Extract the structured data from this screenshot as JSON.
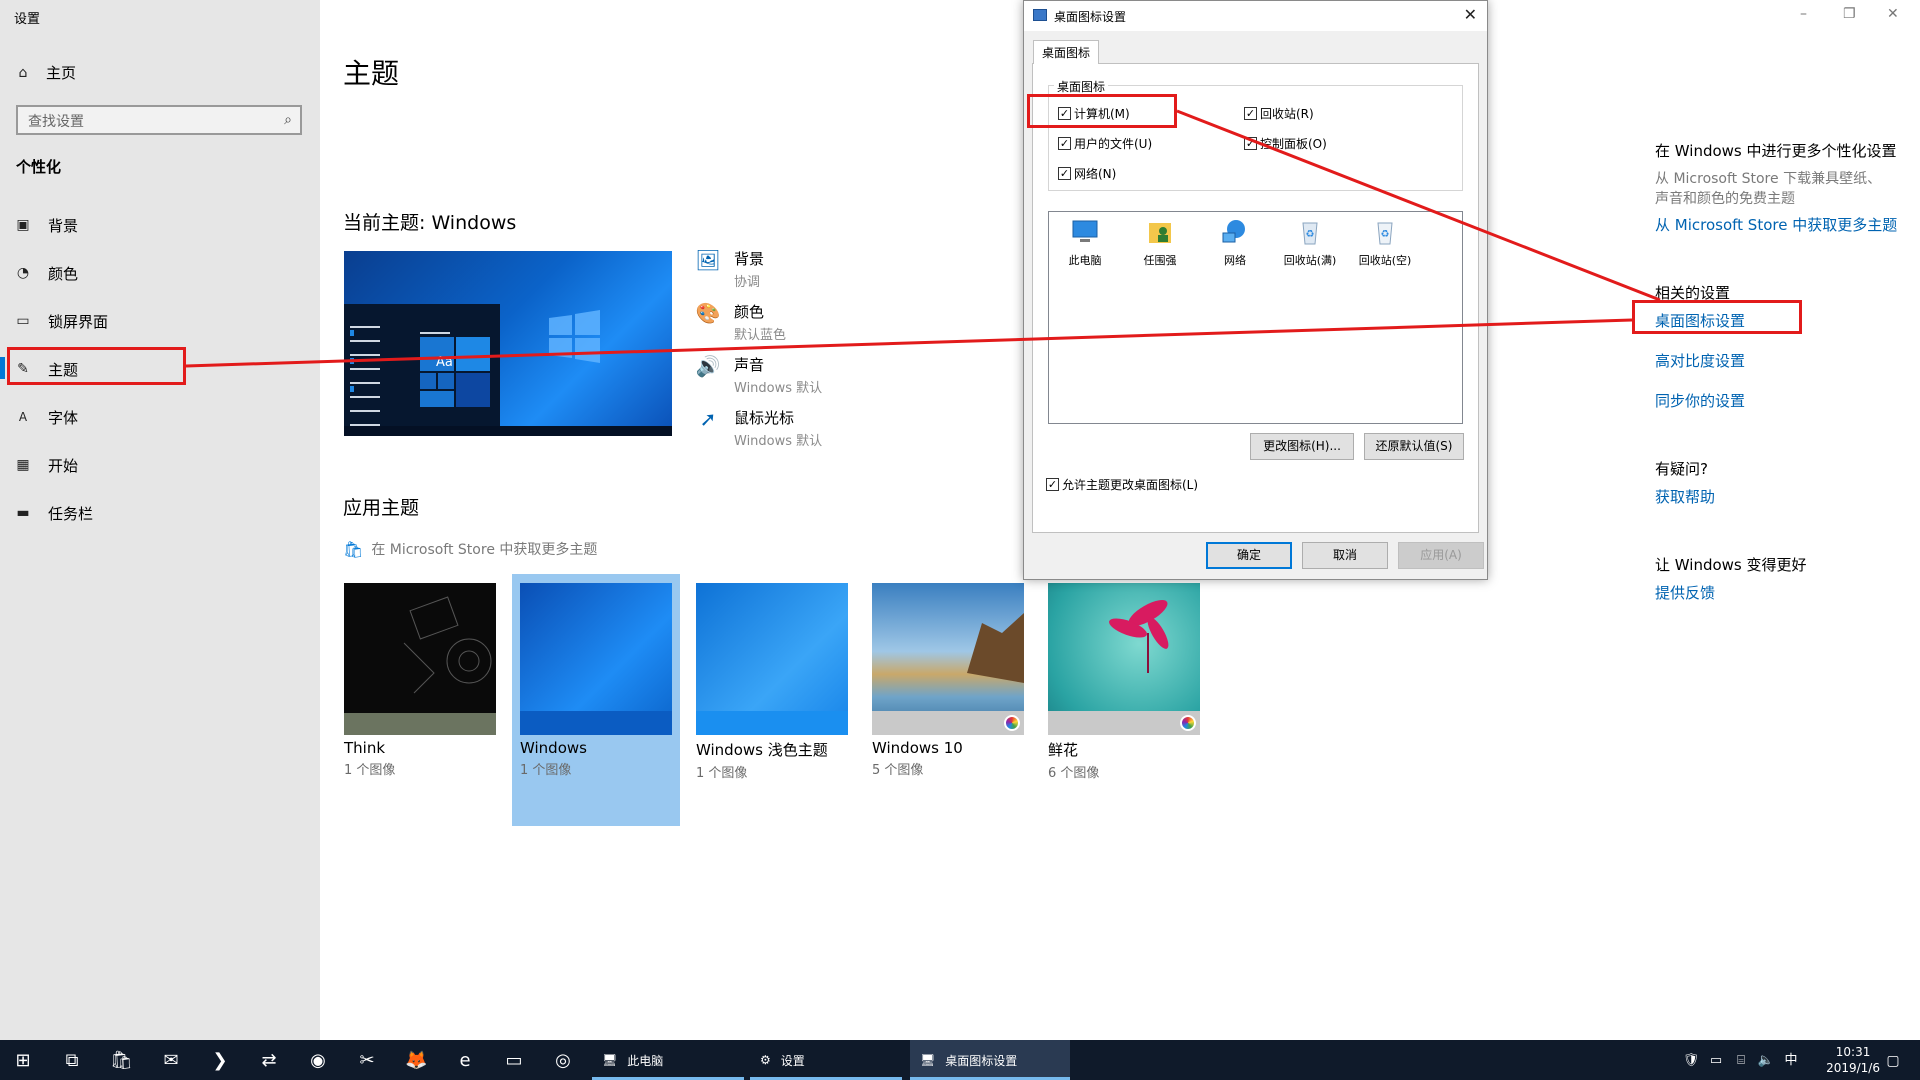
{
  "window": {
    "app_title": "设置",
    "controls": [
      "–",
      "❐",
      "✕"
    ]
  },
  "sidebar": {
    "home_label": "主页",
    "search_placeholder": "查找设置",
    "section_label": "个性化",
    "items": [
      {
        "label": "背景",
        "icon": "picture-icon"
      },
      {
        "label": "颜色",
        "icon": "palette-icon"
      },
      {
        "label": "锁屏界面",
        "icon": "lockscreen-icon"
      },
      {
        "label": "主题",
        "icon": "brush-icon"
      },
      {
        "label": "字体",
        "icon": "font-icon"
      },
      {
        "label": "开始",
        "icon": "start-icon"
      },
      {
        "label": "任务栏",
        "icon": "taskbar-icon"
      }
    ]
  },
  "main": {
    "title": "主题",
    "current_theme": "当前主题: Windows",
    "preview_aa": "Aa",
    "properties": [
      {
        "title": "背景",
        "value": "协调",
        "icon": "picture-icon"
      },
      {
        "title": "颜色",
        "value": "默认蓝色",
        "icon": "palette-icon"
      },
      {
        "title": "声音",
        "value": "Windows 默认",
        "icon": "speaker-icon"
      },
      {
        "title": "鼠标光标",
        "value": "Windows 默认",
        "icon": "cursor-icon"
      }
    ],
    "apply_theme": "应用主题",
    "store_link": "在 Microsoft Store 中获取更多主题",
    "themes": [
      {
        "name": "Think",
        "count": "1 个图像"
      },
      {
        "name": "Windows",
        "count": "1 个图像"
      },
      {
        "name": "Windows 浅色主题",
        "count": "1 个图像"
      },
      {
        "name": "Windows 10",
        "count": "5 个图像"
      },
      {
        "name": "鲜花",
        "count": "6 个图像"
      }
    ]
  },
  "right": {
    "more_title": "在 Windows 中进行更多个性化设置",
    "more_desc1": "从 Microsoft Store 下载兼具壁纸、",
    "more_desc2": "声音和颜色的免费主题",
    "more_link": "从 Microsoft Store 中获取更多主题",
    "related_title": "相关的设置",
    "related_links": [
      "桌面图标设置",
      "高对比度设置",
      "同步你的设置"
    ],
    "help_title": "有疑问?",
    "help_link": "获取帮助",
    "feedback_title": "让 Windows 变得更好",
    "feedback_link": "提供反馈"
  },
  "dialog": {
    "title": "桌面图标设置",
    "tab": "桌面图标",
    "group_label": "桌面图标",
    "checkboxes": [
      {
        "label": "计算机(M)",
        "checked": true
      },
      {
        "label": "回收站(R)",
        "checked": true
      },
      {
        "label": "用户的文件(U)",
        "checked": true
      },
      {
        "label": "控制面板(O)",
        "checked": true
      },
      {
        "label": "网络(N)",
        "checked": true
      }
    ],
    "icons": [
      "此电脑",
      "任围强",
      "网络",
      "回收站(满)",
      "回收站(空)"
    ],
    "change_icon_btn": "更改图标(H)...",
    "restore_btn": "还原默认值(S)",
    "allow_theme_label": "允许主题更改桌面图标(L)",
    "ok_btn": "确定",
    "cancel_btn": "取消",
    "apply_btn": "应用(A)"
  },
  "taskbar": {
    "apps": [
      {
        "label": "此电脑"
      },
      {
        "label": "设置"
      },
      {
        "label": "桌面图标设置"
      }
    ],
    "ime": "中",
    "time": "10:31",
    "date": "2019/1/6"
  },
  "colors": {
    "accent": "#0078d7",
    "link": "#0063b1",
    "annotation": "#e21b1b",
    "sidebar_bg": "#e6e6e6",
    "taskbar_bg": "#0f1a2a"
  }
}
